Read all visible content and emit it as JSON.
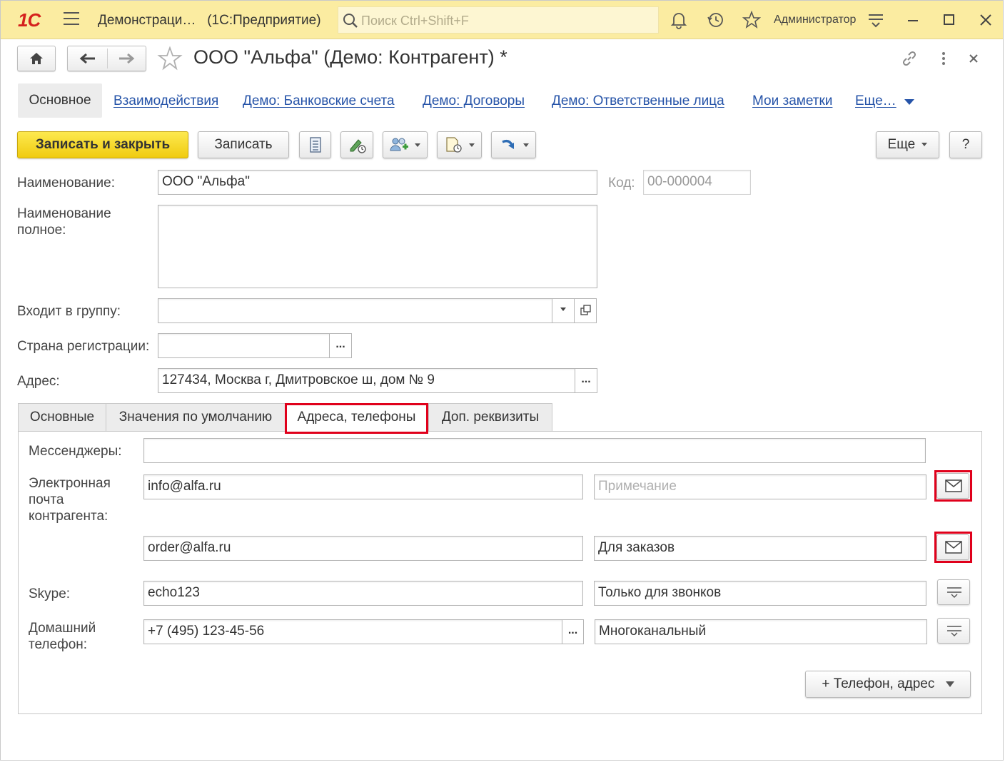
{
  "titlebar": {
    "logo": "1С",
    "app_title": "Демонстраци…   (1С:Предприятие)",
    "search_placeholder": "Поиск Ctrl+Shift+F",
    "user": "Администратор"
  },
  "form": {
    "title": "ООО \"Альфа\" (Демо: Контрагент) *"
  },
  "nav_tabs": {
    "active": "Основное",
    "links": [
      "Взаимодействия",
      "Демо: Банковские счета",
      "Демо: Договоры",
      "Демо: Ответственные лица",
      "Мои заметки",
      "Еще…"
    ]
  },
  "toolbar": {
    "save_close": "Записать и закрыть",
    "save": "Записать",
    "more": "Еще",
    "help": "?"
  },
  "fields": {
    "name_label": "Наименование:",
    "name_value": "ООО \"Альфа\"",
    "code_label": "Код:",
    "code_value": "00-000004",
    "fullname_label_1": "Наименование",
    "fullname_label_2": "полное:",
    "group_label": "Входит в группу:",
    "country_label": "Страна регистрации:",
    "address_label": "Адрес:",
    "address_value": "127434, Москва г, Дмитровское ш, дом № 9",
    "ellipsis": "..."
  },
  "inner_tabs": [
    "Основные",
    "Значения по умолчанию",
    "Адреса, телефоны",
    "Доп. реквизиты"
  ],
  "contacts": {
    "messengers_label": "Мессенджеры:",
    "email_label_1": "Электронная",
    "email_label_2": "почта",
    "email_label_3": "контрагента:",
    "email1": "info@alfa.ru",
    "email1_note_placeholder": "Примечание",
    "email2": "order@alfa.ru",
    "email2_note": "Для заказов",
    "skype_label": "Skype:",
    "skype": "echo123",
    "skype_note": "Только для звонков",
    "phone_label_1": "Домашний",
    "phone_label_2": "телефон:",
    "phone": "+7 (495) 123-45-56",
    "phone_note": "Многоканальный",
    "add_button": "+ Телефон, адрес"
  },
  "colors": {
    "titlebar": "#fbeca1",
    "primary_button": "#f5d726",
    "link": "#2553a8",
    "highlight": "#e0001b"
  }
}
